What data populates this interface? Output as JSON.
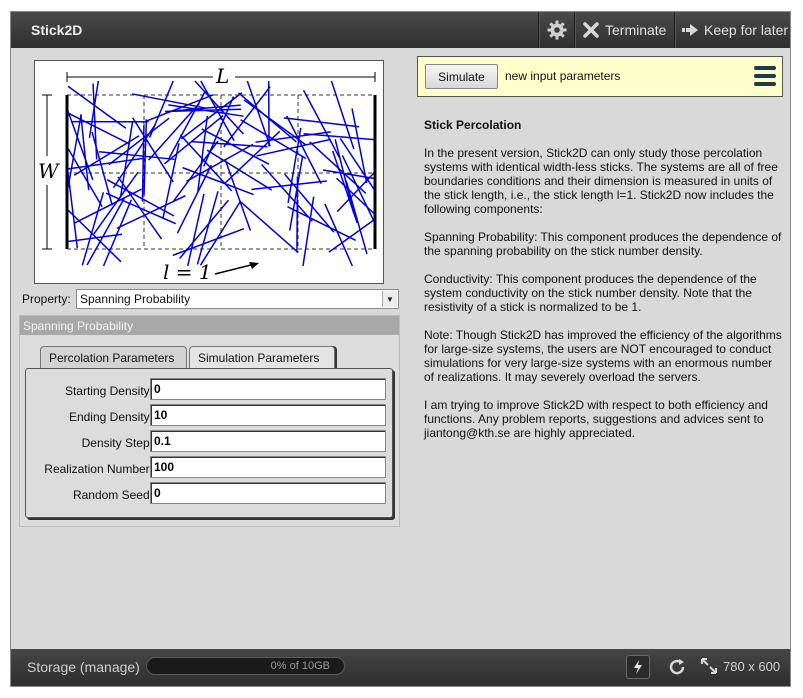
{
  "app": {
    "title": "Stick2D",
    "toolbar": {
      "terminate_label": "Terminate",
      "keep_label": "Keep for later",
      "gear_icon": "gear-icon",
      "terminate_icon": "x-icon",
      "keep_icon": "arrow-right-icon"
    }
  },
  "figure": {
    "label_L": "L",
    "label_W": "W",
    "label_l": "l = 1",
    "stick_color": "#0000dd"
  },
  "property": {
    "label": "Property:",
    "selected": "Spanning Probability"
  },
  "panel": {
    "title": "Spanning Probability",
    "tabs": [
      {
        "label": "Percolation Parameters"
      },
      {
        "label": "Simulation Parameters"
      }
    ],
    "active_tab": "Simulation Parameters",
    "fields": [
      {
        "label": "Starting Density:",
        "value": "0"
      },
      {
        "label": "Ending Density:",
        "value": "10"
      },
      {
        "label": "Density Step:",
        "value": "0.1"
      },
      {
        "label": "Realization Number:",
        "value": "100"
      },
      {
        "label": "Random Seed:",
        "value": "0"
      }
    ]
  },
  "simulate": {
    "button_label": "Simulate",
    "status": "new input parameters",
    "background": "#ffffcc"
  },
  "info": {
    "heading": "Stick Percolation",
    "paragraphs": [
      "In the present version, Stick2D can only study those percolation systems with identical width-less sticks. The systems are all of free boundaries conditions and their dimension is measured in units of the stick length, i.e., the stick length l=1. Stick2D now includes the following components:",
      "Spanning Probability: This component produces the dependence of the spanning probability on the stick number density.",
      "Conductivity: This component produces the dependence of the system conductivity on the stick number density. Note that the resistivity of a stick is normalized to be 1.",
      "Note: Though Stick2D has improved the efficiency of the algorithms for large-size systems, the users are NOT encouraged to conduct simulations for very large-size systems with an enormous number of realizations. It may severely overload the servers.",
      "I am trying to improve Stick2D with respect to both efficiency and functions. Any problem reports, suggestions and advices sent to jiantong@kth.se are highly appreciated."
    ]
  },
  "footer": {
    "storage_label": "Storage (manage)",
    "storage_text": "0% of 10GB",
    "storage_used_fraction": 0,
    "size_label": "780 x 600"
  }
}
